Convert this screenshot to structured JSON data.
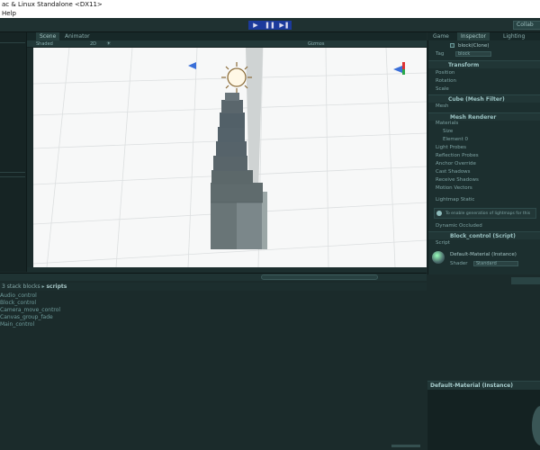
{
  "window": {
    "title": "ac & Linux Standalone <DX11>"
  },
  "menu": {
    "help": "Help"
  },
  "toolbar": {
    "play": "▶",
    "pause": "❚❚",
    "step": "▶❚",
    "collab": "Collab"
  },
  "scene": {
    "tabs": [
      {
        "label": "Scene"
      },
      {
        "label": "Animator"
      }
    ],
    "shading": "Shaded",
    "mode_2d": "2D",
    "gizmos": "Gizmos"
  },
  "inspector": {
    "tabs": [
      {
        "label": "Game"
      },
      {
        "label": "Inspector"
      },
      {
        "label": "Lighting"
      }
    ],
    "object_name": "block(Clone)",
    "tag_label": "Tag",
    "tag_value": "block",
    "transform": {
      "header": "Transform",
      "position": "Position",
      "rotation": "Rotation",
      "scale": "Scale"
    },
    "mesh_filter": {
      "header": "Cube (Mesh Filter)",
      "mesh": "Mesh"
    },
    "mesh_renderer": {
      "header": "Mesh Renderer",
      "materials": "Materials",
      "size": "Size",
      "element": "Element 0",
      "light_probes": "Light Probes",
      "reflection_probes": "Reflection Probes",
      "anchor_override": "Anchor Override",
      "cast_shadows": "Cast Shadows",
      "receive_shadows": "Receive Shadows",
      "motion_vectors": "Motion Vectors",
      "lightmap_static": "Lightmap Static",
      "info": "To enable generation of lightmaps for this",
      "dynamic_occluded": "Dynamic Occluded"
    },
    "script_component": {
      "header": "Block_control (Script)",
      "script_label": "Script"
    },
    "material": {
      "name": "Default-Material (Instance)",
      "shader_label": "Shader",
      "shader_value": "Standard"
    }
  },
  "project": {
    "breadcrumb_prefix": "3 stack blocks",
    "breadcrumb_current": "scripts",
    "files": [
      "Audio_control",
      "Block_control",
      "Camera_move_control",
      "Canvas_group_fade",
      "Main_control"
    ]
  },
  "material_preview": {
    "title": "Default-Material (Instance)"
  }
}
